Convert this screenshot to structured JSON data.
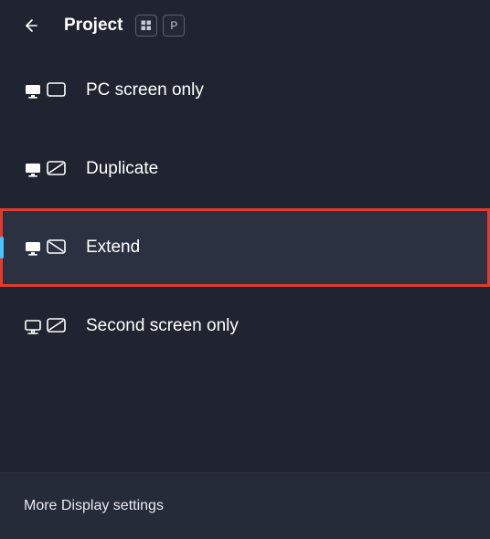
{
  "header": {
    "title": "Project",
    "shortcut_key": "P"
  },
  "options": [
    {
      "id": "pc-only",
      "label": "PC screen only",
      "icon": "pc-screen-only-icon",
      "selected": false,
      "highlighted": false
    },
    {
      "id": "duplicate",
      "label": "Duplicate",
      "icon": "duplicate-icon",
      "selected": false,
      "highlighted": false
    },
    {
      "id": "extend",
      "label": "Extend",
      "icon": "extend-icon",
      "selected": true,
      "highlighted": true
    },
    {
      "id": "second-only",
      "label": "Second screen only",
      "icon": "second-screen-only-icon",
      "selected": false,
      "highlighted": false
    }
  ],
  "footer": {
    "link_label": "More Display settings"
  }
}
